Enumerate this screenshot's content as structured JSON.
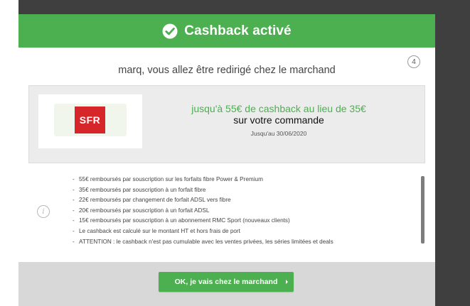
{
  "header": {
    "title": "Cashback activé",
    "icon": "check-circle-icon",
    "color": "#4caf50"
  },
  "step_badge": "4",
  "redirect_message": "marq, vous allez être redirigé chez le marchand",
  "offer": {
    "merchant_logo_text": "SFR",
    "headline": "jusqu'à 55€ de cashback au lieu de 35€",
    "subline": "sur votre commande",
    "validity": "Jusqu'au 30/06/2020",
    "accent_color": "#4caf50",
    "logo_color": "#d6262a"
  },
  "info_icon": "info-icon",
  "conditions": [
    "55€ remboursés par souscription sur les forfaits fibre Power & Premium",
    "35€ remboursés par souscription à un forfait fibre",
    "22€ remboursés par changement de forfait ADSL vers fibre",
    "20€ remboursés par souscription à un forfait ADSL",
    "15€ remboursés par souscription à un abonnement RMC Sport (nouveaux clients)",
    "Le cashback est calculé sur le montant HT et hors frais de port",
    "ATTENTION : le cashback n'est pas cumulable avec les ventes privées, les séries limitées et deals"
  ],
  "footer": {
    "cta_label": "OK, je vais chez le marchand"
  }
}
